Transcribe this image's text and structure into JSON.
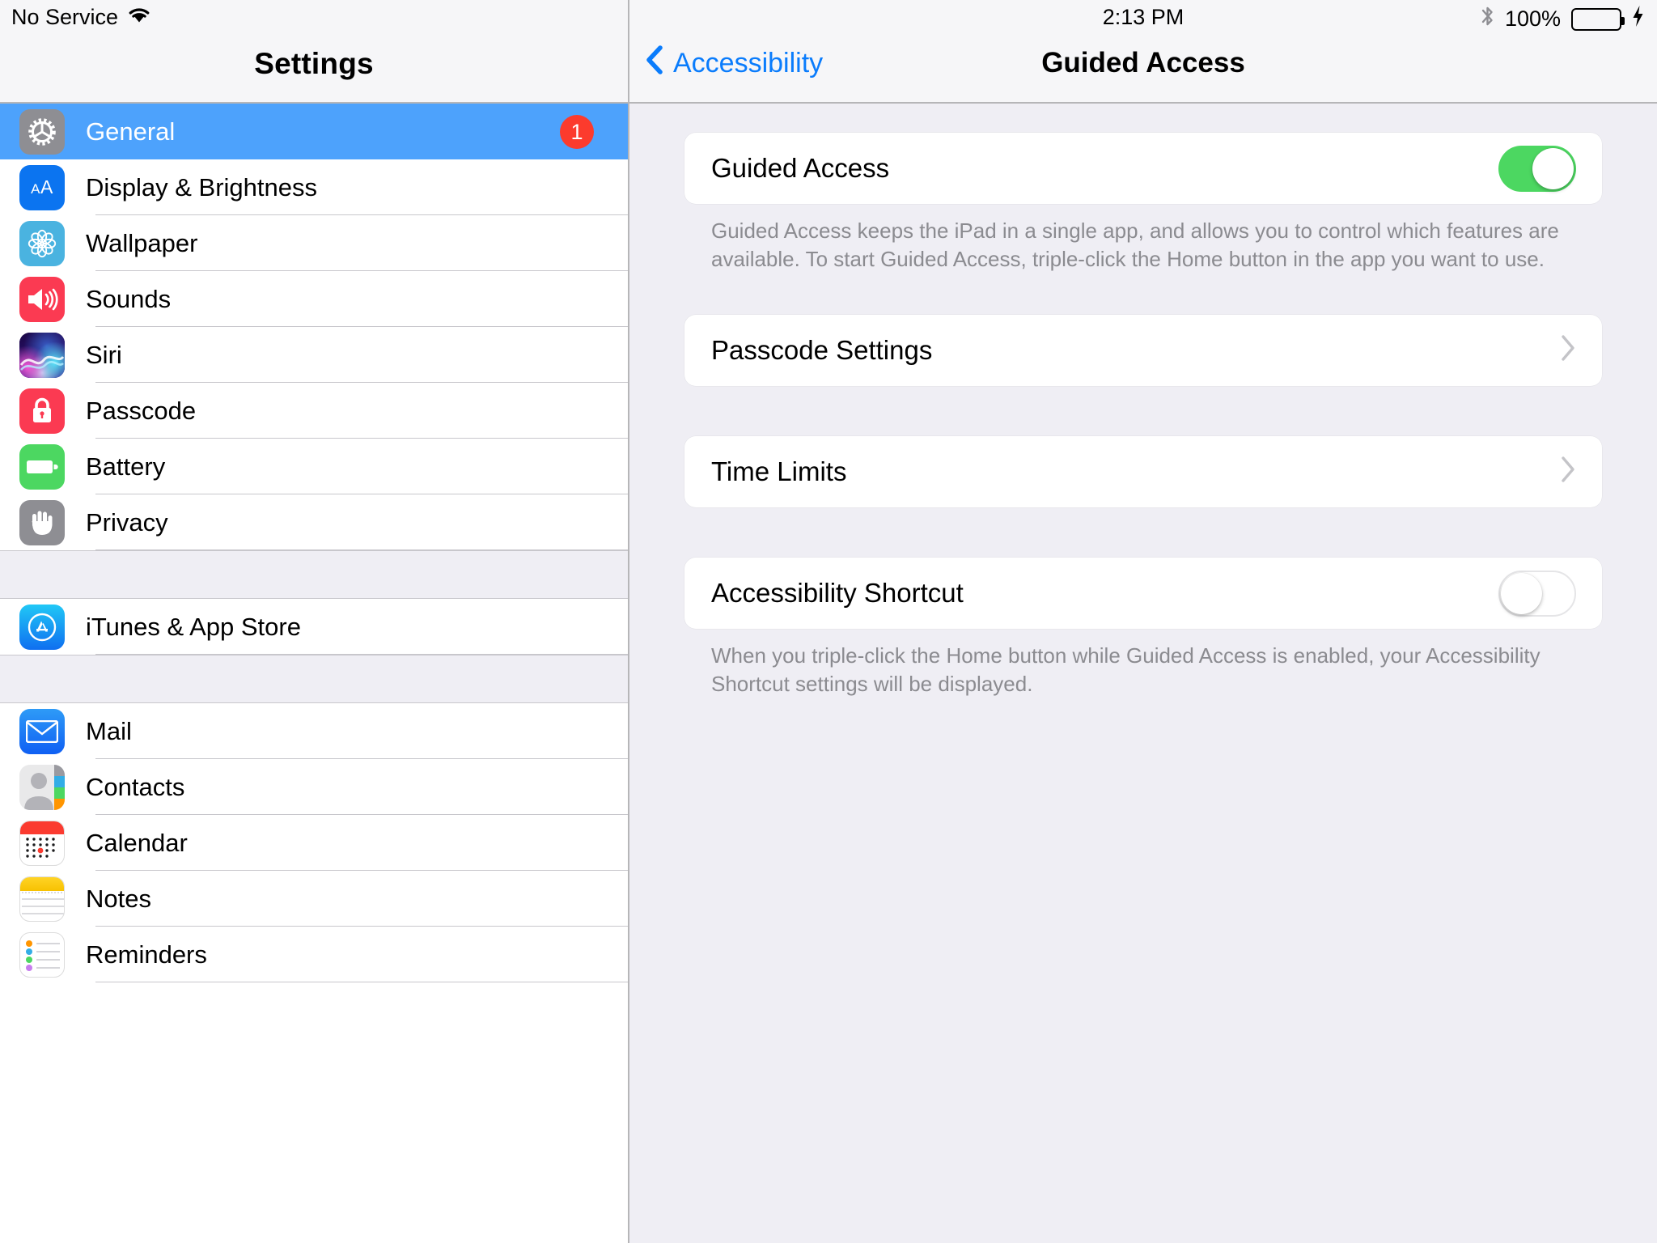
{
  "status_bar": {
    "carrier": "No Service",
    "wifi_icon": "wifi-icon",
    "time": "2:13 PM",
    "bluetooth_icon": "bluetooth-icon",
    "battery_percent": "100%",
    "battery_icon": "battery-full-icon",
    "charging_icon": "lightning-bolt-icon"
  },
  "sidebar": {
    "title": "Settings",
    "groups": [
      {
        "items": [
          {
            "label": "General",
            "icon": "gear-icon",
            "icon_class": "ico-general",
            "selected": true,
            "badge": "1"
          },
          {
            "label": "Display & Brightness",
            "icon": "text-size-icon",
            "icon_class": "ico-display",
            "selected": false,
            "badge": ""
          },
          {
            "label": "Wallpaper",
            "icon": "flower-icon",
            "icon_class": "ico-wallpaper",
            "selected": false,
            "badge": ""
          },
          {
            "label": "Sounds",
            "icon": "speaker-icon",
            "icon_class": "ico-sounds",
            "selected": false,
            "badge": ""
          },
          {
            "label": "Siri",
            "icon": "siri-waves-icon",
            "icon_class": "ico-siri",
            "selected": false,
            "badge": ""
          },
          {
            "label": "Passcode",
            "icon": "lock-icon",
            "icon_class": "ico-passcode",
            "selected": false,
            "badge": ""
          },
          {
            "label": "Battery",
            "icon": "battery-icon",
            "icon_class": "ico-battery",
            "selected": false,
            "badge": ""
          },
          {
            "label": "Privacy",
            "icon": "hand-icon",
            "icon_class": "ico-privacy",
            "selected": false,
            "badge": ""
          }
        ]
      },
      {
        "items": [
          {
            "label": "iTunes & App Store",
            "icon": "app-store-icon",
            "icon_class": "ico-appstore",
            "selected": false,
            "badge": ""
          }
        ]
      },
      {
        "items": [
          {
            "label": "Mail",
            "icon": "envelope-icon",
            "icon_class": "ico-mail",
            "selected": false,
            "badge": ""
          },
          {
            "label": "Contacts",
            "icon": "person-icon",
            "icon_class": "ico-contacts",
            "selected": false,
            "badge": ""
          },
          {
            "label": "Calendar",
            "icon": "calendar-icon",
            "icon_class": "ico-calendar",
            "selected": false,
            "badge": ""
          },
          {
            "label": "Notes",
            "icon": "notepad-icon",
            "icon_class": "ico-notes",
            "selected": false,
            "badge": ""
          },
          {
            "label": "Reminders",
            "icon": "checklist-icon",
            "icon_class": "ico-reminders",
            "selected": false,
            "badge": ""
          }
        ]
      }
    ]
  },
  "content": {
    "back_label": "Accessibility",
    "back_icon": "chevron-left-icon",
    "title": "Guided Access",
    "guided_access": {
      "label": "Guided Access",
      "toggle_state": "on",
      "footnote": "Guided Access keeps the iPad in a single app, and allows you to control which features are available. To start Guided Access, triple-click the Home button in the app you want to use."
    },
    "passcode_settings": {
      "label": "Passcode Settings",
      "chevron_icon": "chevron-right-icon"
    },
    "time_limits": {
      "label": "Time Limits",
      "chevron_icon": "chevron-right-icon"
    },
    "accessibility_shortcut": {
      "label": "Accessibility Shortcut",
      "toggle_state": "off",
      "footnote": "When you triple-click the Home button while Guided Access is enabled, your Accessibility Shortcut settings will be displayed."
    }
  },
  "colors": {
    "accent_blue": "#0a7cfc",
    "selected_row": "#4da2fc",
    "toggle_on_green": "#4cd761",
    "badge_red": "#fc3b2d",
    "page_background": "#efeef4"
  }
}
